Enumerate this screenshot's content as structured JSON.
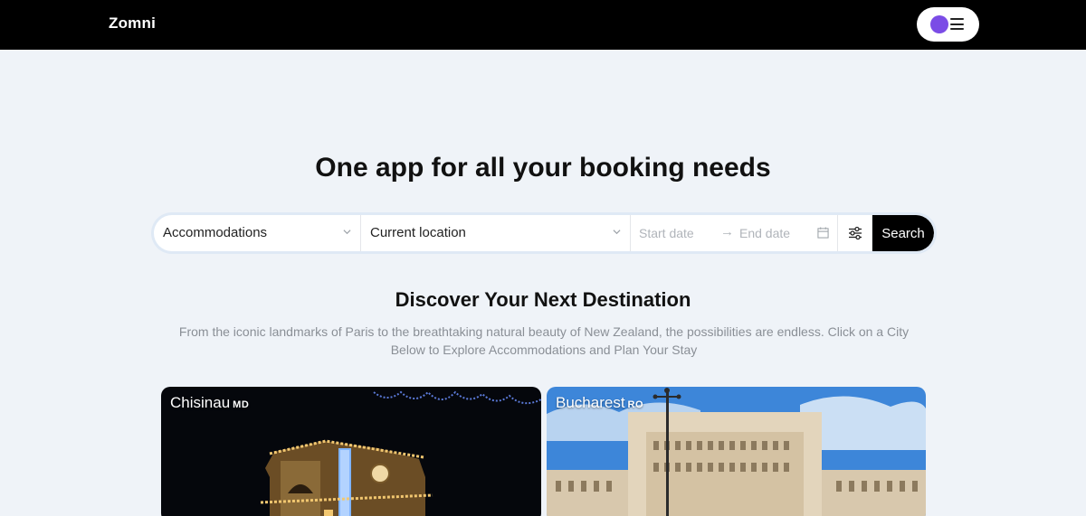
{
  "header": {
    "logo": "Zomni",
    "avatar_color": "#7b4ce6",
    "menu_icon": "hamburger-icon"
  },
  "hero": {
    "title": "One app for all your booking needs"
  },
  "search": {
    "category_value": "Accommodations",
    "location_value": "Current location",
    "start_placeholder": "Start date",
    "end_placeholder": "End date",
    "filter_icon": "sliders-icon",
    "calendar_icon": "calendar-icon",
    "button_label": "Search"
  },
  "discover": {
    "title": "Discover Your Next Destination",
    "description": "From the iconic landmarks of Paris to the breathtaking natural beauty of New Zealand, the possibilities are endless. Click on a City Below to Explore Accommodations and Plan Your Stay"
  },
  "cities": [
    {
      "name": "Chisinau",
      "country_code": "MD"
    },
    {
      "name": "Bucharest",
      "country_code": "RO"
    }
  ]
}
